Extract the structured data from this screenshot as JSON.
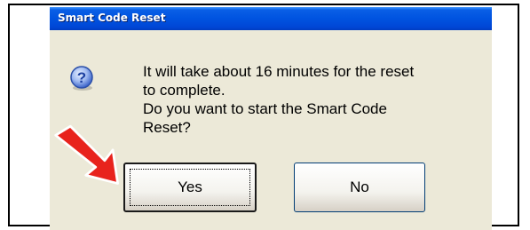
{
  "dialog": {
    "title": "Smart Code Reset",
    "icon": "question-icon",
    "message_lines": [
      "It will take about 16 minutes for the reset",
      "to complete.",
      "Do you want to start the Smart Code",
      "Reset?"
    ],
    "buttons": {
      "yes": "Yes",
      "no": "No"
    },
    "default_button": "yes"
  },
  "annotation": {
    "icon": "red-arrow-icon",
    "color": "#e8231d"
  },
  "colors": {
    "title_bar": "#0053e0",
    "dialog_background": "#ece9d8",
    "question_icon": "#2b55c6"
  }
}
